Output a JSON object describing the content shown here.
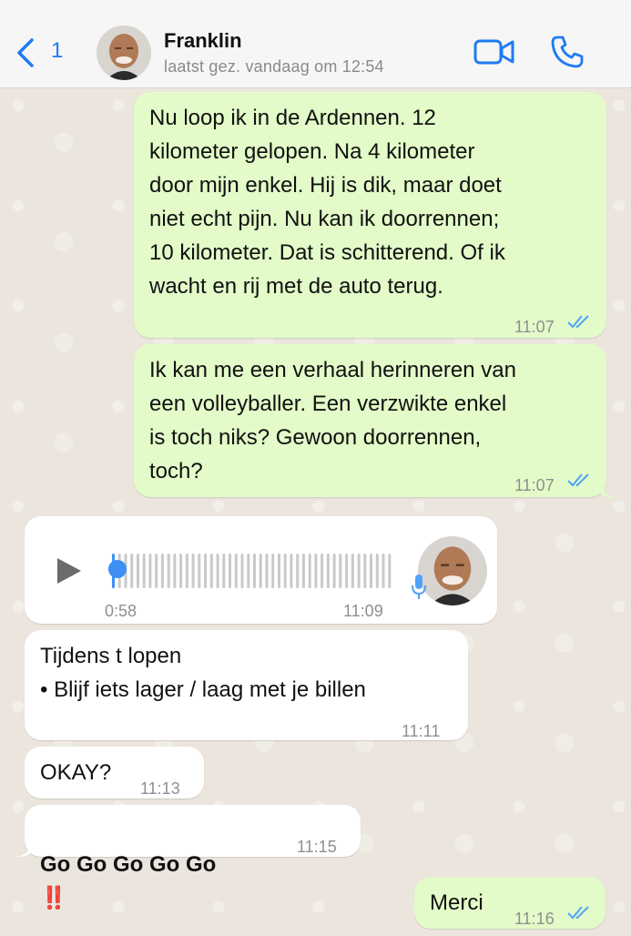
{
  "header": {
    "back_count": "1",
    "contact_name": "Franklin",
    "contact_status": "laatst gez. vandaag om 12:54",
    "icons": [
      "chevron-left-icon",
      "video-camera-icon",
      "phone-icon"
    ],
    "accent_color": "#1f7bf2"
  },
  "messages": [
    {
      "direction": "out",
      "text": "Nu loop ik in de Ardennen. 12\nkilometer gelopen. Na 4 kilometer\ndoor mijn enkel. Hij is dik, maar doet\nniet echt pijn. Nu kan ik doorrennen;\n10 kilometer. Dat is schitterend. Of ik\nwacht en rij met de auto terug.",
      "time": "11:07",
      "read": true
    },
    {
      "direction": "out",
      "text": "Ik kan me een verhaal herinneren van\neen volleyballer. Een verzwikte enkel\nis toch niks? Gewoon doorrennen,\ntoch?",
      "time": "11:07",
      "read": true
    },
    {
      "direction": "in",
      "type": "voice",
      "duration": "0:58",
      "time": "11:09",
      "progress": 0
    },
    {
      "direction": "in",
      "text": "Tijdens t lopen\n• Blijf iets lager / laag met je billen",
      "time": "11:11"
    },
    {
      "direction": "in",
      "text": "OKAY?",
      "time": "11:13"
    },
    {
      "direction": "in",
      "text": "Go Go Go Go Go",
      "emoji": "‼️",
      "time": "11:15"
    },
    {
      "direction": "out",
      "text": "Merci",
      "time": "11:16",
      "read": true
    }
  ],
  "colors": {
    "outgoing_bubble": "#e2fbc8",
    "incoming_bubble": "#ffffff",
    "read_ticks": "#4fa3f7"
  }
}
